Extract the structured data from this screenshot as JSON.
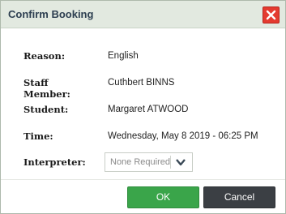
{
  "dialog": {
    "title": "Confirm Booking",
    "close_icon": "close-icon",
    "fields": {
      "reason": {
        "label": "Reason:",
        "value": "English"
      },
      "staff_member": {
        "label": "Staff Member:",
        "value": "Cuthbert BINNS"
      },
      "student": {
        "label": "Student:",
        "value": "Margaret ATWOOD"
      },
      "time": {
        "label": "Time:",
        "value": "Wednesday, May 8 2019 - 06:25 PM"
      },
      "interpreter": {
        "label": "Interpreter:",
        "selected": "None Required",
        "icon": "chevron-down-icon"
      }
    },
    "buttons": {
      "ok_label": "OK",
      "cancel_label": "Cancel"
    }
  },
  "colors": {
    "titlebar_bg": "#e2e9e0",
    "close_red": "#e43b30",
    "ok_green": "#3aa54a",
    "cancel_dark": "#3b3f44"
  }
}
